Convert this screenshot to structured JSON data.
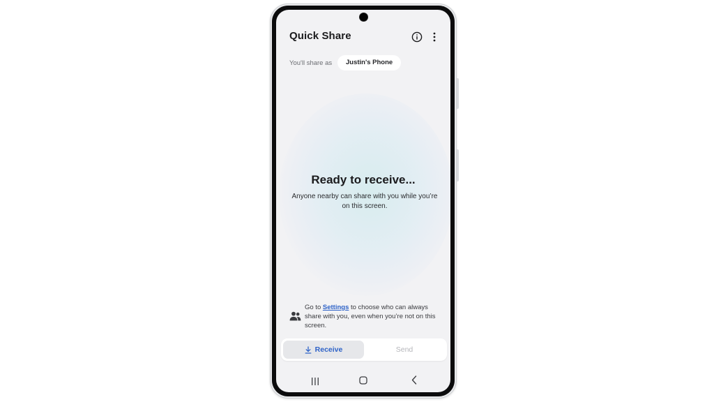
{
  "app": {
    "title": "Quick Share"
  },
  "header": {
    "info_icon": "info-icon",
    "more_icon": "more-vertical-icon"
  },
  "identity": {
    "label": "You'll share as",
    "device_name": "Justin's Phone"
  },
  "status": {
    "title": "Ready to receive...",
    "description": "Anyone nearby can share with you while you’re on this screen."
  },
  "settings_note": {
    "prefix": "Go to ",
    "link_label": "Settings",
    "suffix": " to choose who can always share with you, even when you’re not on this screen.",
    "icon": "people-icon"
  },
  "tabs": [
    {
      "label": "Receive",
      "icon": "download-icon",
      "selected": true
    },
    {
      "label": "Send",
      "selected": false
    }
  ],
  "navigation_bar": {
    "recents_icon": "recents-icon",
    "home_icon": "home-icon",
    "back_icon": "back-icon"
  },
  "colors": {
    "accent": "#2f63c8",
    "background": "#f2f2f4",
    "disabled_text": "#b5b6ba"
  }
}
